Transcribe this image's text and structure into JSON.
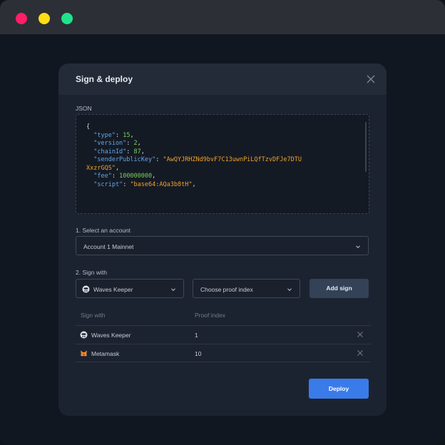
{
  "window": {
    "colors": {
      "close": "#ff1f66",
      "minimize": "#ffde16",
      "maximize": "#1fe38c"
    }
  },
  "dialog": {
    "title": "Sign & deploy",
    "json_label": "JSON",
    "json_lines": [
      "{",
      "  \"type\": 15,",
      "  \"version\": 2,",
      "  \"chainId\": 87,",
      "  \"senderPublicKey\": \"AwQYJRHZNd9bvF7C13uwnPiLQfTzvDFJe7DTU",
      "XxzrGQS\",",
      "  \"fee\": 100000000,",
      "  \"script\": \"base64:AQa3b8tH\","
    ],
    "account": {
      "label": "1. Select an account",
      "selected": "Account 1 Mainnet"
    },
    "sign": {
      "label": "2. Sign with",
      "method": "Waves Keeper",
      "method_icon": "waves-keeper-icon",
      "proof_placeholder": "Choose proof index",
      "add_label": "Add sign"
    },
    "table": {
      "headers": [
        "Sign with",
        "Proof index"
      ],
      "rows": [
        {
          "name": "Waves Keeper",
          "icon": "waves-keeper-icon",
          "proof": "1"
        },
        {
          "name": "Metamask",
          "icon": "metamask-icon",
          "proof": "10"
        }
      ]
    },
    "deploy_label": "Deploy",
    "accent": "#3a7bea"
  }
}
